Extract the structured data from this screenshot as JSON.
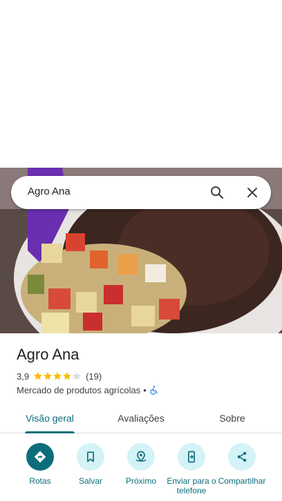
{
  "search": {
    "query": "Agro Ana"
  },
  "place": {
    "name": "Agro Ana",
    "rating_value": "3,9",
    "rating_stars": 3.9,
    "review_count": "(19)",
    "category": "Mercado de produtos agrícolas",
    "separator": "•"
  },
  "tabs": [
    {
      "label": "Visão geral",
      "active": true
    },
    {
      "label": "Avaliações",
      "active": false
    },
    {
      "label": "Sobre",
      "active": false
    }
  ],
  "actions": [
    {
      "label": "Rotas",
      "icon": "directions-icon"
    },
    {
      "label": "Salvar",
      "icon": "bookmark-icon"
    },
    {
      "label": "Próximo",
      "icon": "nearby-icon"
    },
    {
      "label": "Enviar para o telefone",
      "icon": "send-to-phone-icon"
    },
    {
      "label": "Compartilhar",
      "icon": "share-icon"
    }
  ],
  "colors": {
    "accent": "#0b6e7a",
    "action_bg": "#d3f3f7",
    "star": "#fbbc04",
    "star_empty": "#dadce0"
  }
}
